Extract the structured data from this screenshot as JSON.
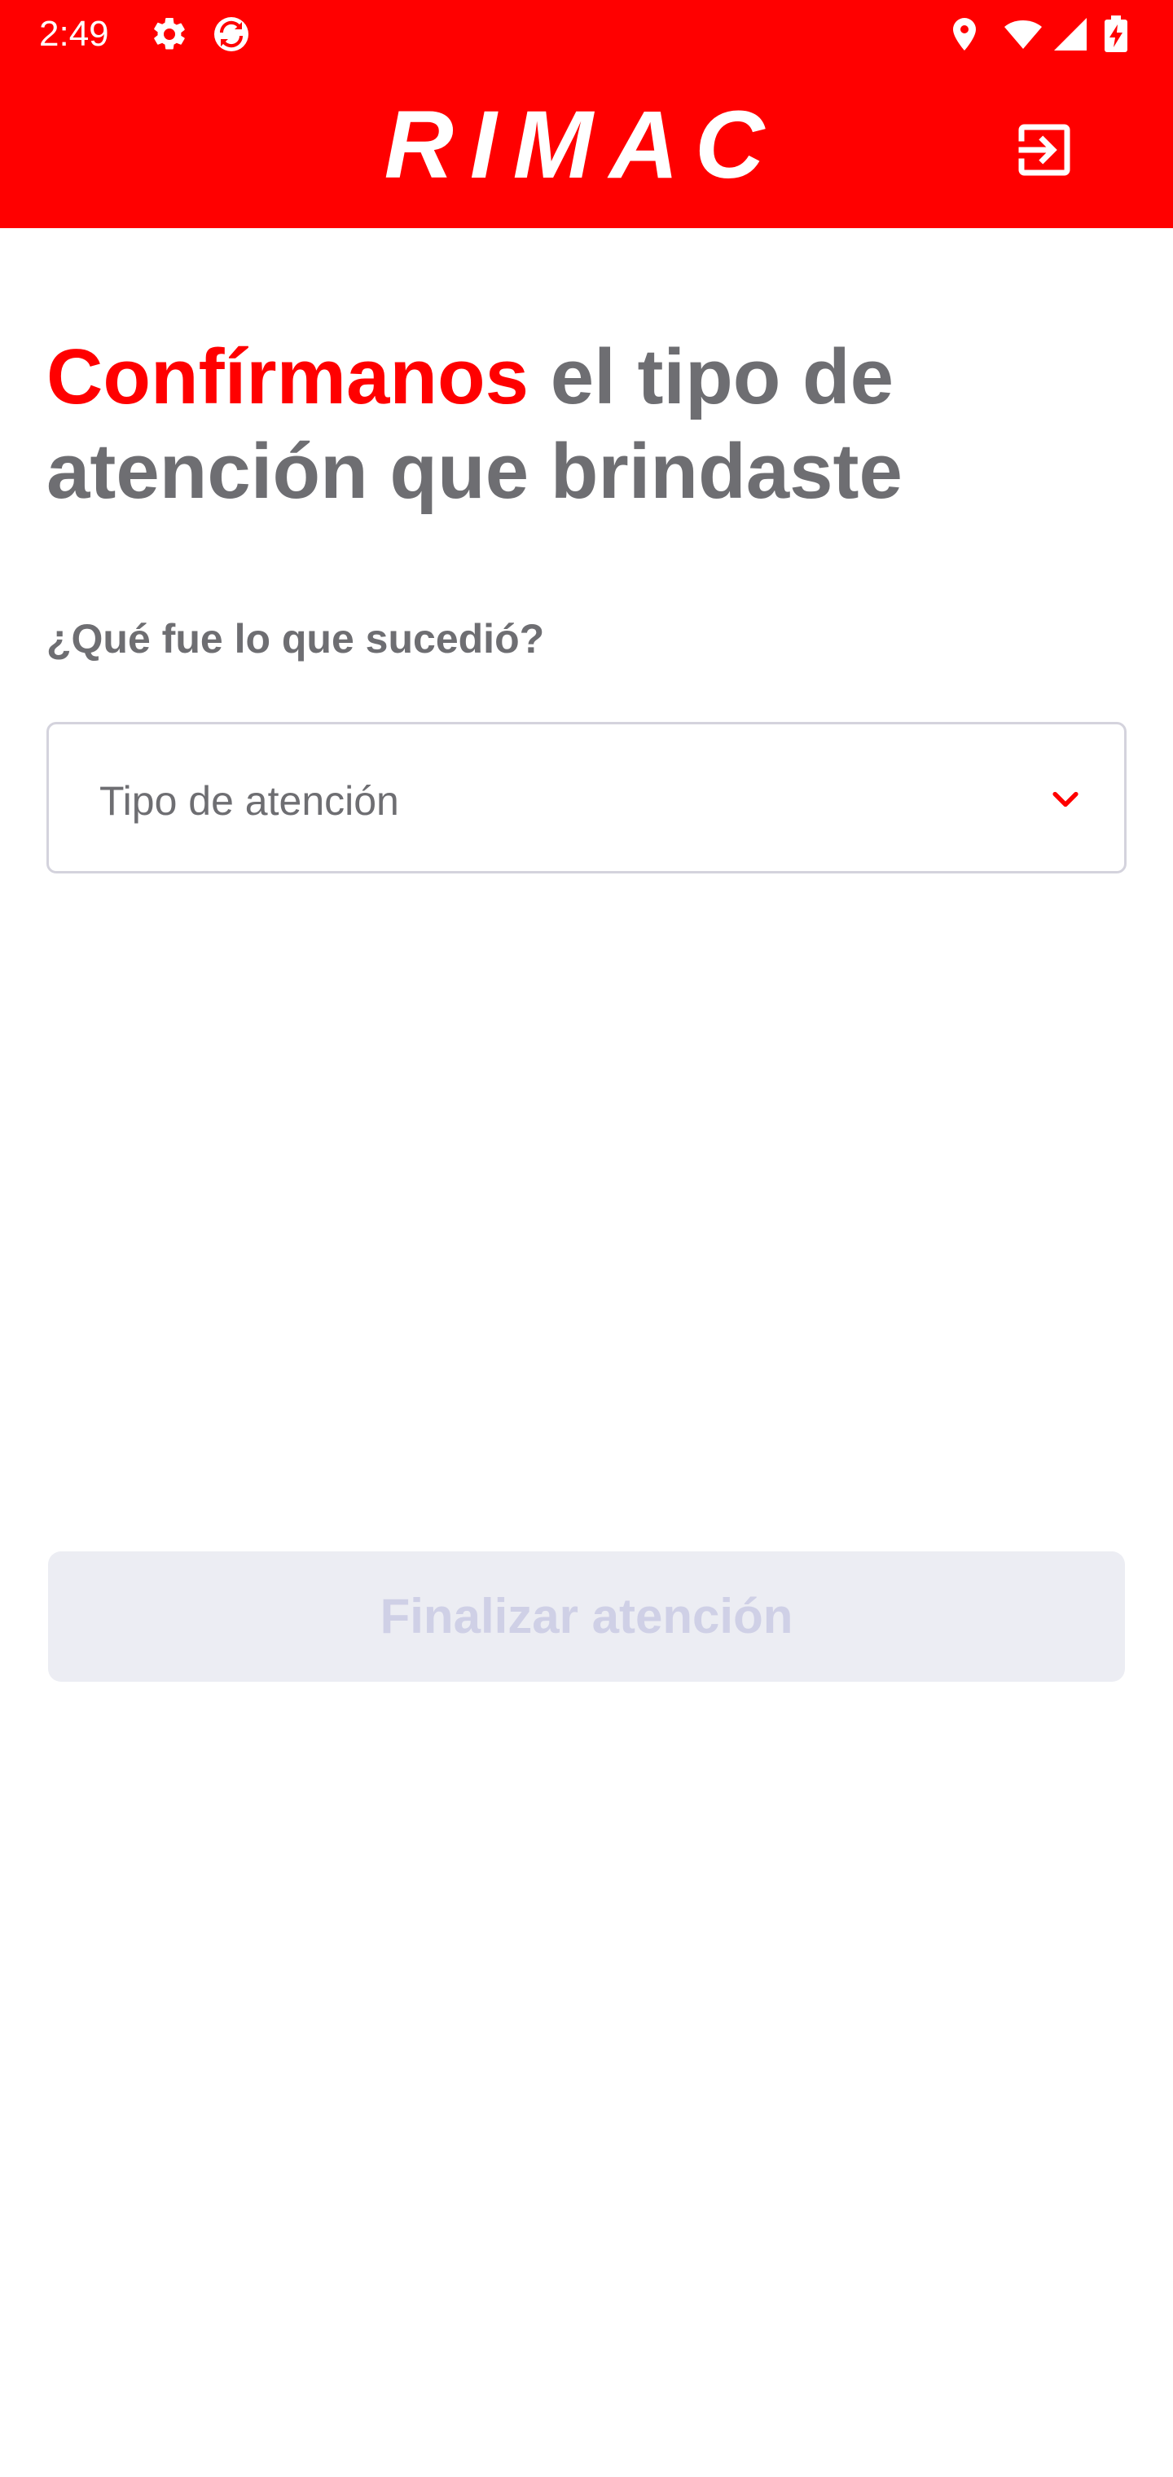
{
  "status_bar": {
    "time": "2:49",
    "icons": [
      "settings-icon",
      "sync-app-icon",
      "location-icon",
      "wifi-icon",
      "signal-icon",
      "battery-charging-icon"
    ]
  },
  "app_bar": {
    "logo_text": "RIMAC",
    "logout_icon": "logout-icon"
  },
  "main": {
    "title_accent": "Confírmanos",
    "title_rest": " el tipo de atención que brindaste",
    "question": "¿Qué fue lo que sucedió?",
    "select": {
      "placeholder": "Tipo de atención",
      "chevron_icon": "chevron-down-icon"
    },
    "finish_button": {
      "label": "Finalizar atención",
      "enabled": false
    }
  },
  "colors": {
    "brand_red": "#ff0000",
    "text_gray": "#6e6e72",
    "disabled_bg": "#ecedf3",
    "disabled_text": "#cfd0e6",
    "field_border": "#d4d3dd"
  }
}
